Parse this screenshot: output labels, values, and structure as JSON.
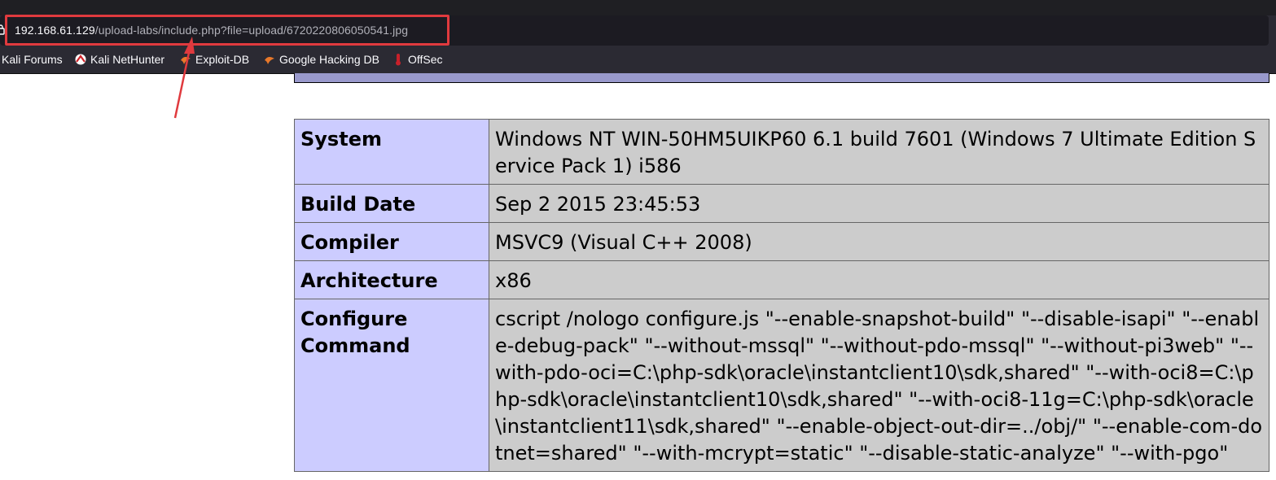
{
  "browser": {
    "url_host": "192.168.61.129",
    "url_path": "/upload-labs/include.php?file=upload/6720220806050541.jpg",
    "bookmarks": [
      {
        "label": "Kali Forums",
        "icon": "kali-forums-icon"
      },
      {
        "label": "Kali NetHunter",
        "icon": "kali-nethunter-icon"
      },
      {
        "label": "Exploit-DB",
        "icon": "exploit-db-icon"
      },
      {
        "label": "Google Hacking DB",
        "icon": "google-hacking-db-icon"
      },
      {
        "label": "OffSec",
        "icon": "offsec-icon"
      }
    ]
  },
  "annotation": {
    "color": "#e03a3e"
  },
  "phpinfo": {
    "rows": [
      {
        "key": "System",
        "value": "Windows NT WIN-50HM5UIKP60 6.1 build 7601 (Windows 7 Ultimate Edition Service Pack 1) i586"
      },
      {
        "key": "Build Date",
        "value": "Sep 2 2015 23:45:53"
      },
      {
        "key": "Compiler",
        "value": "MSVC9 (Visual C++ 2008)"
      },
      {
        "key": "Architecture",
        "value": "x86"
      },
      {
        "key": "Configure Command",
        "value": "cscript /nologo configure.js \"--enable-snapshot-build\" \"--disable-isapi\" \"--enable-debug-pack\" \"--without-mssql\" \"--without-pdo-mssql\" \"--without-pi3web\" \"--with-pdo-oci=C:\\php-sdk\\oracle\\instantclient10\\sdk,shared\" \"--with-oci8=C:\\php-sdk\\oracle\\instantclient10\\sdk,shared\" \"--with-oci8-11g=C:\\php-sdk\\oracle\\instantclient11\\sdk,shared\" \"--enable-object-out-dir=../obj/\" \"--enable-com-dotnet=shared\" \"--with-mcrypt=static\" \"--disable-static-analyze\" \"--with-pgo\""
      }
    ]
  }
}
